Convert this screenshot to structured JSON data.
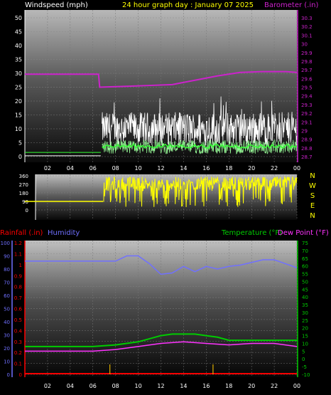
{
  "header": {
    "left_label": "Windspeed (mph)",
    "title": "24 hour graph day : January 07 2025",
    "right_label": "Barometer (.in)"
  },
  "colors": {
    "windspeed": "#ffffff",
    "gust_green": "#33ff33",
    "barometer": "#cc22cc",
    "wind_direction": "#ffff00",
    "rainfall": "#ff0000",
    "humidity": "#7070ff",
    "temperature": "#00cc00",
    "dew_point": "#ff33ff",
    "axis_white": "#ffffff"
  },
  "x_ticks": [
    "02",
    "04",
    "06",
    "08",
    "10",
    "12",
    "14",
    "16",
    "18",
    "20",
    "22",
    "00"
  ],
  "direction_compass": [
    "N",
    "W",
    "S",
    "E",
    "N"
  ],
  "lower_header": {
    "rainfall_label": "Rainfall (.in)",
    "humidity_label": "Humidity",
    "temperature_label": "Temperature (°F)",
    "dew_point_label": "Dew Point (°F)"
  },
  "chart_data": [
    {
      "type": "line",
      "panel": "wind_barometer",
      "x_range_hours": [
        0,
        24
      ],
      "ylim_left": [
        0,
        50
      ],
      "yticks_left": [
        "50",
        "45",
        "40",
        "35",
        "30",
        "25",
        "20",
        "15",
        "10",
        "5",
        "0"
      ],
      "ylim_right": [
        28.7,
        30.3
      ],
      "yticks_right": [
        "30.3",
        "30.2",
        "30.1",
        "30",
        "29.9",
        "29.8",
        "29.7",
        "29.6",
        "29.5",
        "29.4",
        "29.3",
        "29.2",
        "29.1",
        "29",
        "28.9",
        "28.8",
        "28.7"
      ],
      "series": [
        {
          "name": "Windspeed (mph)",
          "axis": "left",
          "note": "calm until ~06:40, then gusty 0-20",
          "x": [
            0,
            6.7,
            6.8,
            24
          ],
          "y": [
            0,
            0,
            8,
            8
          ]
        },
        {
          "name": "Barometer (.in)",
          "axis": "right",
          "x": [
            0,
            6.5,
            6.6,
            9,
            11,
            13,
            15,
            17,
            19,
            21,
            23,
            24
          ],
          "y": [
            29.65,
            29.65,
            29.5,
            29.51,
            29.52,
            29.53,
            29.58,
            29.63,
            29.67,
            29.68,
            29.68,
            29.67
          ]
        }
      ]
    },
    {
      "type": "line",
      "panel": "wind_direction",
      "ylim": [
        0,
        360
      ],
      "yticks": [
        "360",
        "270",
        "180",
        "90",
        "0"
      ],
      "series": [
        {
          "name": "Wind direction",
          "x": [
            0,
            6.9,
            7.0,
            24
          ],
          "y": [
            90,
            90,
            270,
            250
          ]
        }
      ]
    },
    {
      "type": "line",
      "panel": "rain_humidity_temperature",
      "ylim_humidity": [
        0,
        100
      ],
      "yticks_humidity": [
        "100",
        "90",
        "80",
        "70",
        "60",
        "50",
        "40",
        "30",
        "20",
        "10",
        "0"
      ],
      "ylim_rain": [
        0,
        1.2
      ],
      "yticks_rain": [
        "1.2",
        "1.1",
        "1",
        "0.9",
        "0.8",
        "0.7",
        "0.6",
        "0.5",
        "0.4",
        "0.3",
        "0.2",
        "0.1",
        "0"
      ],
      "ylim_temp": [
        -10,
        75
      ],
      "yticks_temp": [
        "75",
        "70",
        "65",
        "60",
        "55",
        "50",
        "45",
        "40",
        "35",
        "30",
        "25",
        "20",
        "15",
        "10",
        "5",
        "0",
        "-5",
        "-10"
      ],
      "series": [
        {
          "name": "Humidity",
          "x": [
            0,
            6,
            8,
            9,
            10,
            11,
            12,
            13,
            14,
            15,
            16,
            17,
            18,
            19,
            20,
            21,
            22,
            23,
            24
          ],
          "y": [
            86,
            86,
            86,
            90,
            90,
            84,
            76,
            77,
            82,
            78,
            82,
            80,
            82,
            83,
            85,
            87,
            87,
            84,
            81
          ]
        },
        {
          "name": "Temperature (°F)",
          "x": [
            0,
            6,
            8,
            10,
            12,
            13,
            14,
            15,
            16,
            17,
            18,
            20,
            22,
            24
          ],
          "y": [
            8,
            8,
            9,
            11,
            15,
            16,
            16,
            16,
            15,
            14,
            12,
            12,
            12,
            12
          ]
        },
        {
          "name": "Dew Point (°F)",
          "x": [
            0,
            6,
            8,
            10,
            12,
            14,
            16,
            18,
            20,
            22,
            24
          ],
          "y": [
            5,
            5,
            6,
            8,
            10,
            11,
            10,
            9,
            10,
            10,
            8
          ]
        },
        {
          "name": "Rainfall (.in)",
          "x": [
            0,
            24
          ],
          "y": [
            0,
            0
          ]
        }
      ]
    }
  ]
}
